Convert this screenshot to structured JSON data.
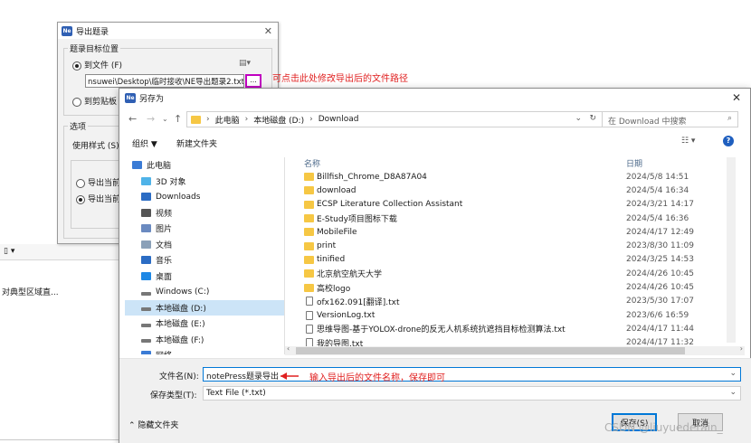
{
  "background": {
    "toolbar_glyph": "▯ ▾",
    "text": "对典型区域直..."
  },
  "export_dialog": {
    "app_icon": "Ne",
    "title": "导出题录",
    "target_group": "题录目标位置",
    "to_file_label": "到文件 (F)",
    "file_path": "nsuwei\\Desktop\\临时接收\\NE导出题录2.txt",
    "browse_label": "...",
    "clipboard_label": "到剪贴板",
    "options_group": "选项",
    "style_label": "使用样式 (S)",
    "option_a": "导出当前",
    "option_b": "导出当前"
  },
  "annotation_path": "可点击此处修改导出后的文件路径",
  "save_dialog": {
    "title": "另存为",
    "breadcrumb": [
      "此电脑",
      "本地磁盘 (D:)",
      "Download"
    ],
    "search_placeholder": "在 Download 中搜索",
    "organize": "组织 ▼",
    "new_folder": "新建文件夹",
    "col_name": "名称",
    "col_date": "日期",
    "nav_items": [
      {
        "label": "此电脑",
        "icon": "computer-icon"
      },
      {
        "label": "3D 对象",
        "icon": "cube-icon"
      },
      {
        "label": "Downloads",
        "icon": "download-icon"
      },
      {
        "label": "视频",
        "icon": "video-icon"
      },
      {
        "label": "图片",
        "icon": "picture-icon"
      },
      {
        "label": "文档",
        "icon": "document-icon"
      },
      {
        "label": "音乐",
        "icon": "music-icon"
      },
      {
        "label": "桌面",
        "icon": "desktop-icon"
      },
      {
        "label": "Windows (C:)",
        "icon": "drive-icon"
      },
      {
        "label": "本地磁盘 (D:)",
        "icon": "drive-icon",
        "selected": true
      },
      {
        "label": "本地磁盘 (E:)",
        "icon": "drive-icon"
      },
      {
        "label": "本地磁盘 (F:)",
        "icon": "drive-icon"
      },
      {
        "label": "网络",
        "icon": "network-icon"
      }
    ],
    "files": [
      {
        "name": "Billfish_Chrome_D8A87A04",
        "date": "2024/5/8 14:51",
        "kind": "folder"
      },
      {
        "name": "download",
        "date": "2024/5/4 16:34",
        "kind": "folder"
      },
      {
        "name": "ECSP Literature Collection Assistant",
        "date": "2024/3/21 14:17",
        "kind": "folder"
      },
      {
        "name": "E-Study项目图标下载",
        "date": "2024/5/4 16:36",
        "kind": "folder"
      },
      {
        "name": "MobileFile",
        "date": "2024/4/17 12:49",
        "kind": "folder"
      },
      {
        "name": "print",
        "date": "2023/8/30 11:09",
        "kind": "folder"
      },
      {
        "name": "tinified",
        "date": "2024/3/25 14:53",
        "kind": "folder"
      },
      {
        "name": "北京航空航天大学",
        "date": "2024/4/26 10:45",
        "kind": "folder"
      },
      {
        "name": "高校logo",
        "date": "2024/4/26 10:45",
        "kind": "folder"
      },
      {
        "name": "ofx162.091[翻译].txt",
        "date": "2023/5/30 17:07",
        "kind": "file"
      },
      {
        "name": "VersionLog.txt",
        "date": "2023/6/6 16:59",
        "kind": "file"
      },
      {
        "name": "思维导图-基于YOLOX-drone的反无人机系统抗遮挡目标检测算法.txt",
        "date": "2024/4/17 11:44",
        "kind": "file"
      },
      {
        "name": "我的导图.txt",
        "date": "2024/4/17 11:32",
        "kind": "file"
      }
    ],
    "filename_label": "文件名(N):",
    "filename_value": "notePress题录导出",
    "filetype_label": "保存类型(T):",
    "filetype_value": "Text File (*.txt)",
    "hide_folders": "隐藏文件夹",
    "save_button": "保存(S)",
    "cancel_button": "取消"
  },
  "annotation_name": "输入导出后的文件名称，保存即可",
  "watermark": "CSDN @liuyuederain_",
  "colors": {
    "annotation": "#e02020",
    "highlight": "#c000c0",
    "selection": "#cce4f7",
    "folder": "#f6c744",
    "accent": "#0078d7"
  }
}
